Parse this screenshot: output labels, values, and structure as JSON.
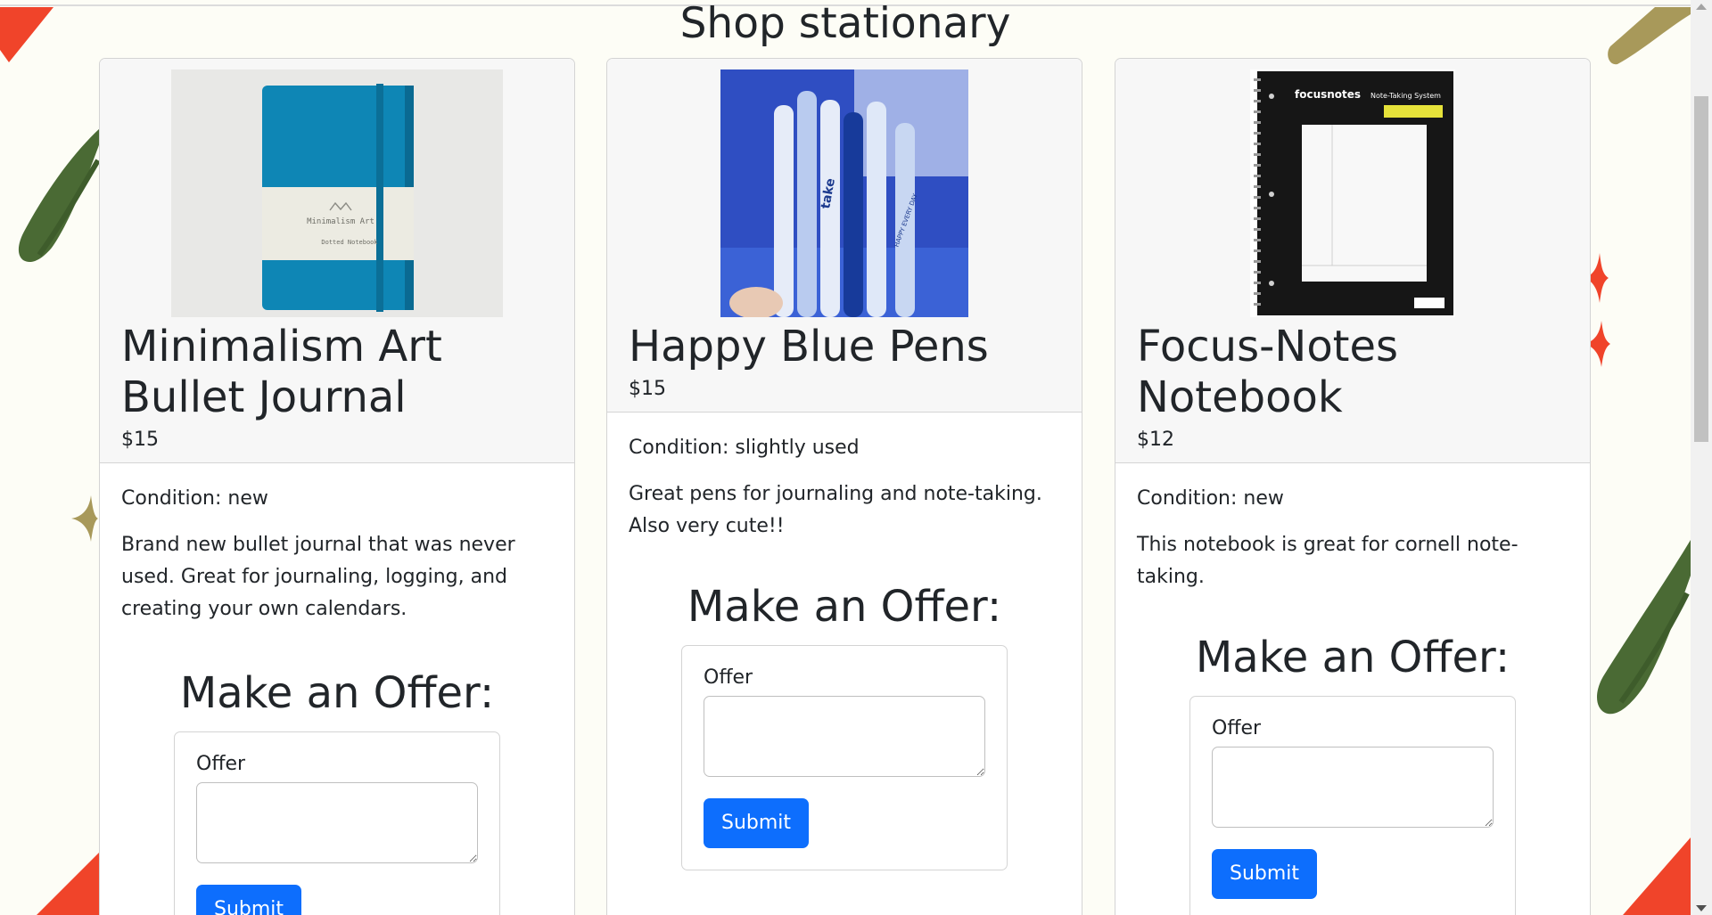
{
  "page": {
    "title": "Shop stationary"
  },
  "colors": {
    "accent_red": "#f0442a",
    "accent_green": "#4a6a34",
    "accent_olive": "#a8995a",
    "button_blue": "#0d6efd"
  },
  "products": [
    {
      "name": "Minimalism Art Bullet Journal",
      "price": "$15",
      "condition": "Condition: new",
      "description": "Brand new bullet journal that was never used. Great for journaling, logging, and creating your own calendars.",
      "image_alt": "Teal bullet journal with Minimalism Art band",
      "image_cover_text": "Minimalism Art",
      "image_sub_text": "Dotted Notebook",
      "offer_title": "Make an Offer:",
      "offer_label": "Offer",
      "offer_value": "",
      "submit_label": "Submit"
    },
    {
      "name": "Happy Blue Pens",
      "price": "$15",
      "condition": "Condition: slightly used",
      "description": "Great pens for journaling and note-taking. Also very cute!!",
      "image_alt": "Set of cute blue and white pens",
      "image_pen_text_1": "take",
      "image_pen_text_2": "HAPPY EVERY DAY",
      "offer_title": "Make an Offer:",
      "offer_label": "Offer",
      "offer_value": "",
      "submit_label": "Submit"
    },
    {
      "name": "Focus-Notes Notebook",
      "price": "$12",
      "condition": "Condition: new",
      "description": "This notebook is great for cornell note-taking.",
      "image_alt": "Black spiral Focus Notes notebook",
      "image_brand": "focusnotes",
      "image_system": "Note-Taking System",
      "offer_title": "Make an Offer:",
      "offer_label": "Offer",
      "offer_value": "",
      "submit_label": "Submit"
    }
  ]
}
